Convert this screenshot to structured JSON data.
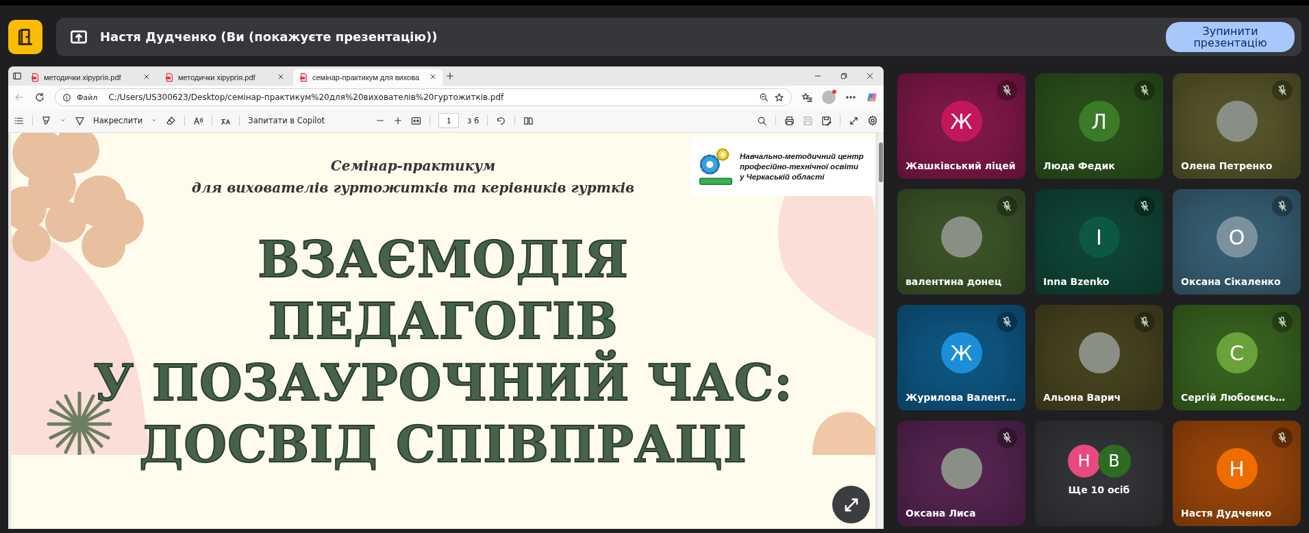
{
  "meeting": {
    "presenter_banner": "Настя Дудченко (Ви (покажуєте презентацію))",
    "stop_button": "Зупинити презентацію"
  },
  "browser": {
    "tabs": [
      {
        "title": "методички хірургія.pdf",
        "selected": false
      },
      {
        "title": "методички хірургія.pdf",
        "selected": false
      },
      {
        "title": "семінар-практикум для вихова",
        "selected": true
      }
    ],
    "address": {
      "scheme_label": "Файл",
      "url": "C:/Users/US300623/Desktop/семінар-практикум%20для%20вихователів%20гуртожитків.pdf"
    },
    "pdf_toolbar": {
      "draw_label": "Накреслити",
      "copilot_label": "Запитати в Copilot",
      "page": "1",
      "page_total": "з 6"
    }
  },
  "slide": {
    "subtitle": [
      "Семінар-практикум",
      "для вихователів гуртожитків та керівників гуртків"
    ],
    "logo_text": [
      "Навчально-методичний центр",
      "професійно-технічної освіти",
      "у Черкаській області"
    ],
    "title": [
      "ВЗАЄМОДІЯ",
      "ПЕДАГОГІВ",
      "У ПОЗАУРОЧНИЙ ЧАС:",
      "ДОСВІД СПІВПРАЦІ"
    ]
  },
  "participants": [
    {
      "name": "Жашківський ліцей",
      "kind": "letter",
      "color": "#7e1848",
      "avatar": {
        "initial": "Ж",
        "color": "#c2185b"
      },
      "muted": true
    },
    {
      "name": "Люда Федик",
      "kind": "letter",
      "color": "#2b501c",
      "avatar": {
        "initial": "Л",
        "color": "#3b7a26"
      },
      "muted": true
    },
    {
      "name": "Олена Петренко",
      "kind": "photo",
      "color": "#55542a",
      "muted": true
    },
    {
      "name": "валентина донец",
      "kind": "photo",
      "color": "#3a5328",
      "muted": true
    },
    {
      "name": "Inna Bzenko",
      "kind": "letter",
      "color": "#0f4536",
      "avatar": {
        "initial": "I",
        "color": "#0d5843"
      },
      "muted": true
    },
    {
      "name": "Оксана Сікаленко",
      "kind": "letter",
      "color": "#375e72",
      "avatar": {
        "initial": "О",
        "color": "#7b929e"
      },
      "muted": true
    },
    {
      "name": "Журилова Валент…",
      "kind": "letter",
      "color": "#0e5580",
      "avatar": {
        "initial": "Ж",
        "color": "#1a8fd8"
      },
      "muted": true
    },
    {
      "name": "Альона Варич",
      "kind": "photo",
      "color": "#47421f",
      "muted": true
    },
    {
      "name": "Сергій Любоємсь…",
      "kind": "letter",
      "color": "#37621f",
      "avatar": {
        "initial": "С",
        "color": "#6aa23a"
      },
      "muted": true
    },
    {
      "name": "Оксана Лиса",
      "kind": "photo",
      "color": "#542450",
      "muted": true
    },
    {
      "kind": "more",
      "label": "Ще 10 осіб",
      "color": "#333437",
      "avatars": [
        {
          "initial": "Н",
          "color": "#e84a7f"
        },
        {
          "initial": "В",
          "color": "#2e6b22"
        }
      ]
    },
    {
      "name": "Настя Дудченко",
      "kind": "letter",
      "color": "#98450a",
      "avatar": {
        "initial": "Н",
        "color": "#ef6c00"
      },
      "muted": true
    }
  ]
}
